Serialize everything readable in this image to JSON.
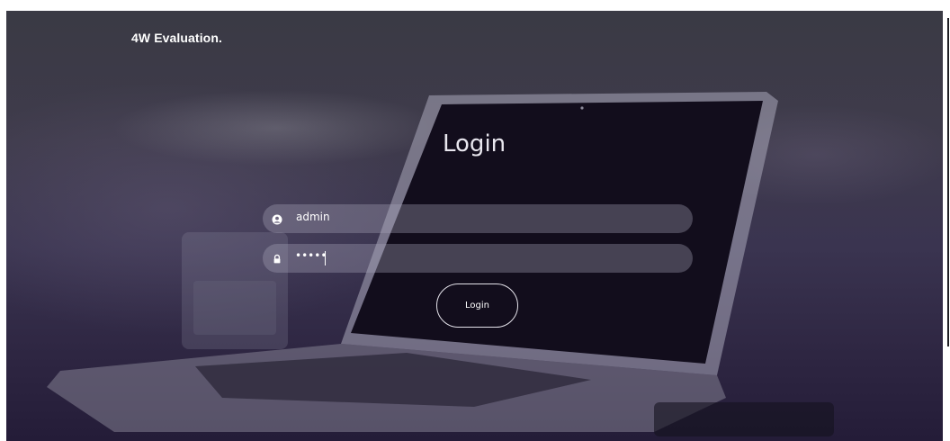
{
  "brand": {
    "name": "4W Evaluation."
  },
  "form": {
    "title": "Login",
    "username": {
      "value": "admin",
      "icon": "user-icon"
    },
    "password": {
      "masked_value": "•••••",
      "icon": "lock-icon"
    },
    "submit_label": "Login"
  },
  "colors": {
    "backdrop_top": "#3a3a44",
    "backdrop_bottom": "#241c38",
    "screen": "#120d1c",
    "field_bg": "rgba(170,165,185,0.35)",
    "text": "#ffffff"
  }
}
